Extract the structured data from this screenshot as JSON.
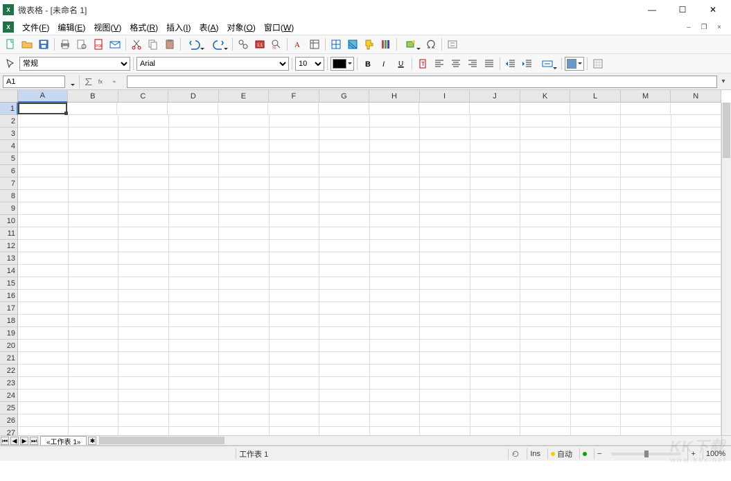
{
  "app": {
    "name": "微表格",
    "document": "未命名 1",
    "title": "微表格 - [未命名 1]"
  },
  "menu": {
    "file": {
      "label": "文件",
      "hotkey": "F"
    },
    "edit": {
      "label": "编辑",
      "hotkey": "E"
    },
    "view": {
      "label": "视图",
      "hotkey": "V"
    },
    "format": {
      "label": "格式",
      "hotkey": "R"
    },
    "insert": {
      "label": "插入",
      "hotkey": "I"
    },
    "table": {
      "label": "表",
      "hotkey": "A"
    },
    "object": {
      "label": "对象",
      "hotkey": "O"
    },
    "window": {
      "label": "窗口",
      "hotkey": "W"
    }
  },
  "format_row": {
    "style_selected": "常规",
    "font_selected": "Arial",
    "size_selected": "10"
  },
  "reference": {
    "cell": "A1",
    "formula": ""
  },
  "columns": [
    "A",
    "B",
    "C",
    "D",
    "E",
    "F",
    "G",
    "H",
    "I",
    "J",
    "K",
    "L",
    "M",
    "N"
  ],
  "rows_visible": 28,
  "active_cell": {
    "row": 1,
    "col": "A"
  },
  "sheet": {
    "tab_label": "«工作表 1»",
    "status_label": "工作表 1"
  },
  "status": {
    "ins": "Ins",
    "auto": "自动",
    "zoom": "100%"
  },
  "watermark": {
    "brand": "KK下载",
    "url": "www.kkx.net"
  }
}
